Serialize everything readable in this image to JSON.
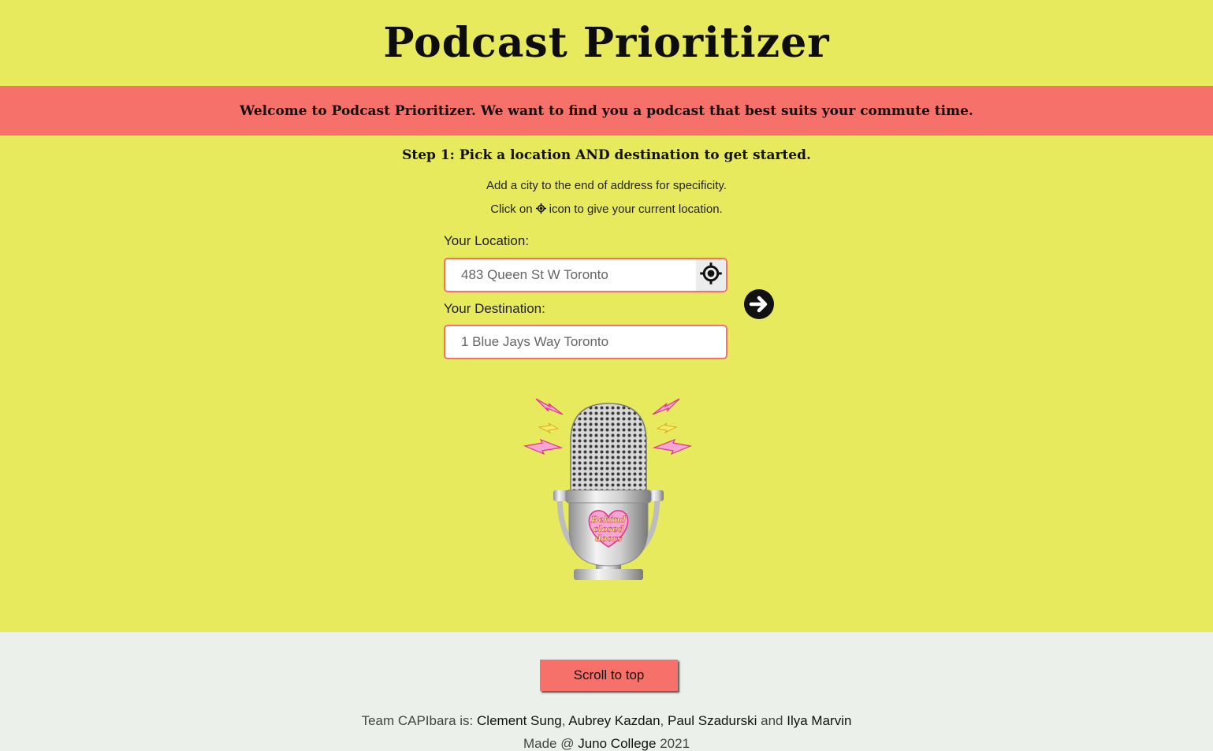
{
  "header": {
    "title": "Podcast Prioritizer"
  },
  "banner": {
    "text": "Welcome to Podcast Prioritizer. We want to find you a podcast that best suits your commute time."
  },
  "step": {
    "heading": "Step 1: Pick a location AND destination to get started.",
    "hint_city": "Add a city to the end of address for specificity.",
    "hint_click_prefix": "Click on",
    "hint_click_suffix": "icon to give your current location."
  },
  "form": {
    "location_label": "Your Location:",
    "location_placeholder": "483 Queen St W Toronto",
    "destination_label": "Your Destination:",
    "destination_placeholder": "1 Blue Jays Way Toronto",
    "locate_icon": "crosshair-icon",
    "submit_icon": "arrow-right-circle-icon"
  },
  "illustration": {
    "name": "microphone-illustration",
    "badge_text": "Behind closed doors"
  },
  "footer": {
    "scroll_top_label": "Scroll to top",
    "team_prefix": "Team CAPIbara is:",
    "members": [
      "Clement Sung",
      "Aubrey Kazdan",
      "Paul Szadurski",
      "Ilya Marvin"
    ],
    "sep_comma": ",",
    "sep_and": "and",
    "made_prefix": "Made @",
    "school": "Juno College",
    "year": "2021"
  },
  "colors": {
    "background": "#e8ea5e",
    "accent": "#f6716a",
    "footer_background": "#ecf0ea"
  }
}
